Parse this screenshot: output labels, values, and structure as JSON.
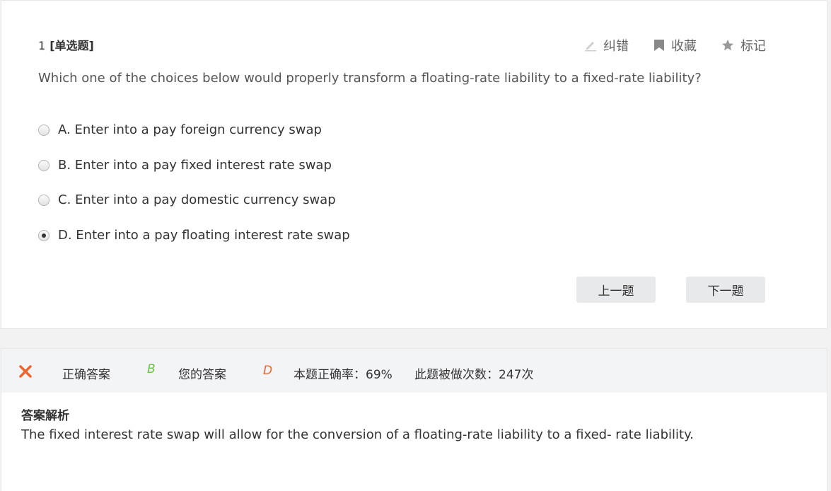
{
  "question": {
    "number": "1",
    "type": "[单选题]",
    "stem": "Which one of the choices below would properly transform a floating-rate liability to a fixed-rate liability?",
    "options": [
      {
        "label": "A. Enter into a pay foreign currency swap",
        "checked": false
      },
      {
        "label": "B. Enter into a pay fixed interest rate swap",
        "checked": false
      },
      {
        "label": "C. Enter into a pay domestic currency swap",
        "checked": false
      },
      {
        "label": "D. Enter into a pay floating interest rate swap",
        "checked": true
      }
    ]
  },
  "actions": {
    "correct_error": "纠错",
    "favorite": "收藏",
    "mark": "标记"
  },
  "nav": {
    "prev": "上一题",
    "next": "下一题"
  },
  "result": {
    "correct_answer": "B",
    "correct_answer_label": "正确答案",
    "your_answer": "D",
    "your_answer_label": "您的答案",
    "accuracy": "本题正确率：69%",
    "attempts": "此题被做次数：247次"
  },
  "explanation": {
    "title": "答案解析",
    "text": "The fixed interest rate swap will allow for the conversion of a floating-rate liability to a fixed- rate liability."
  },
  "colors": {
    "correct": "#6cc04a",
    "wrong": "#f0642d",
    "x_icon": "#f0642d"
  },
  "icons": [
    "pencil-icon",
    "bookmark-icon",
    "star-icon",
    "x-icon"
  ]
}
